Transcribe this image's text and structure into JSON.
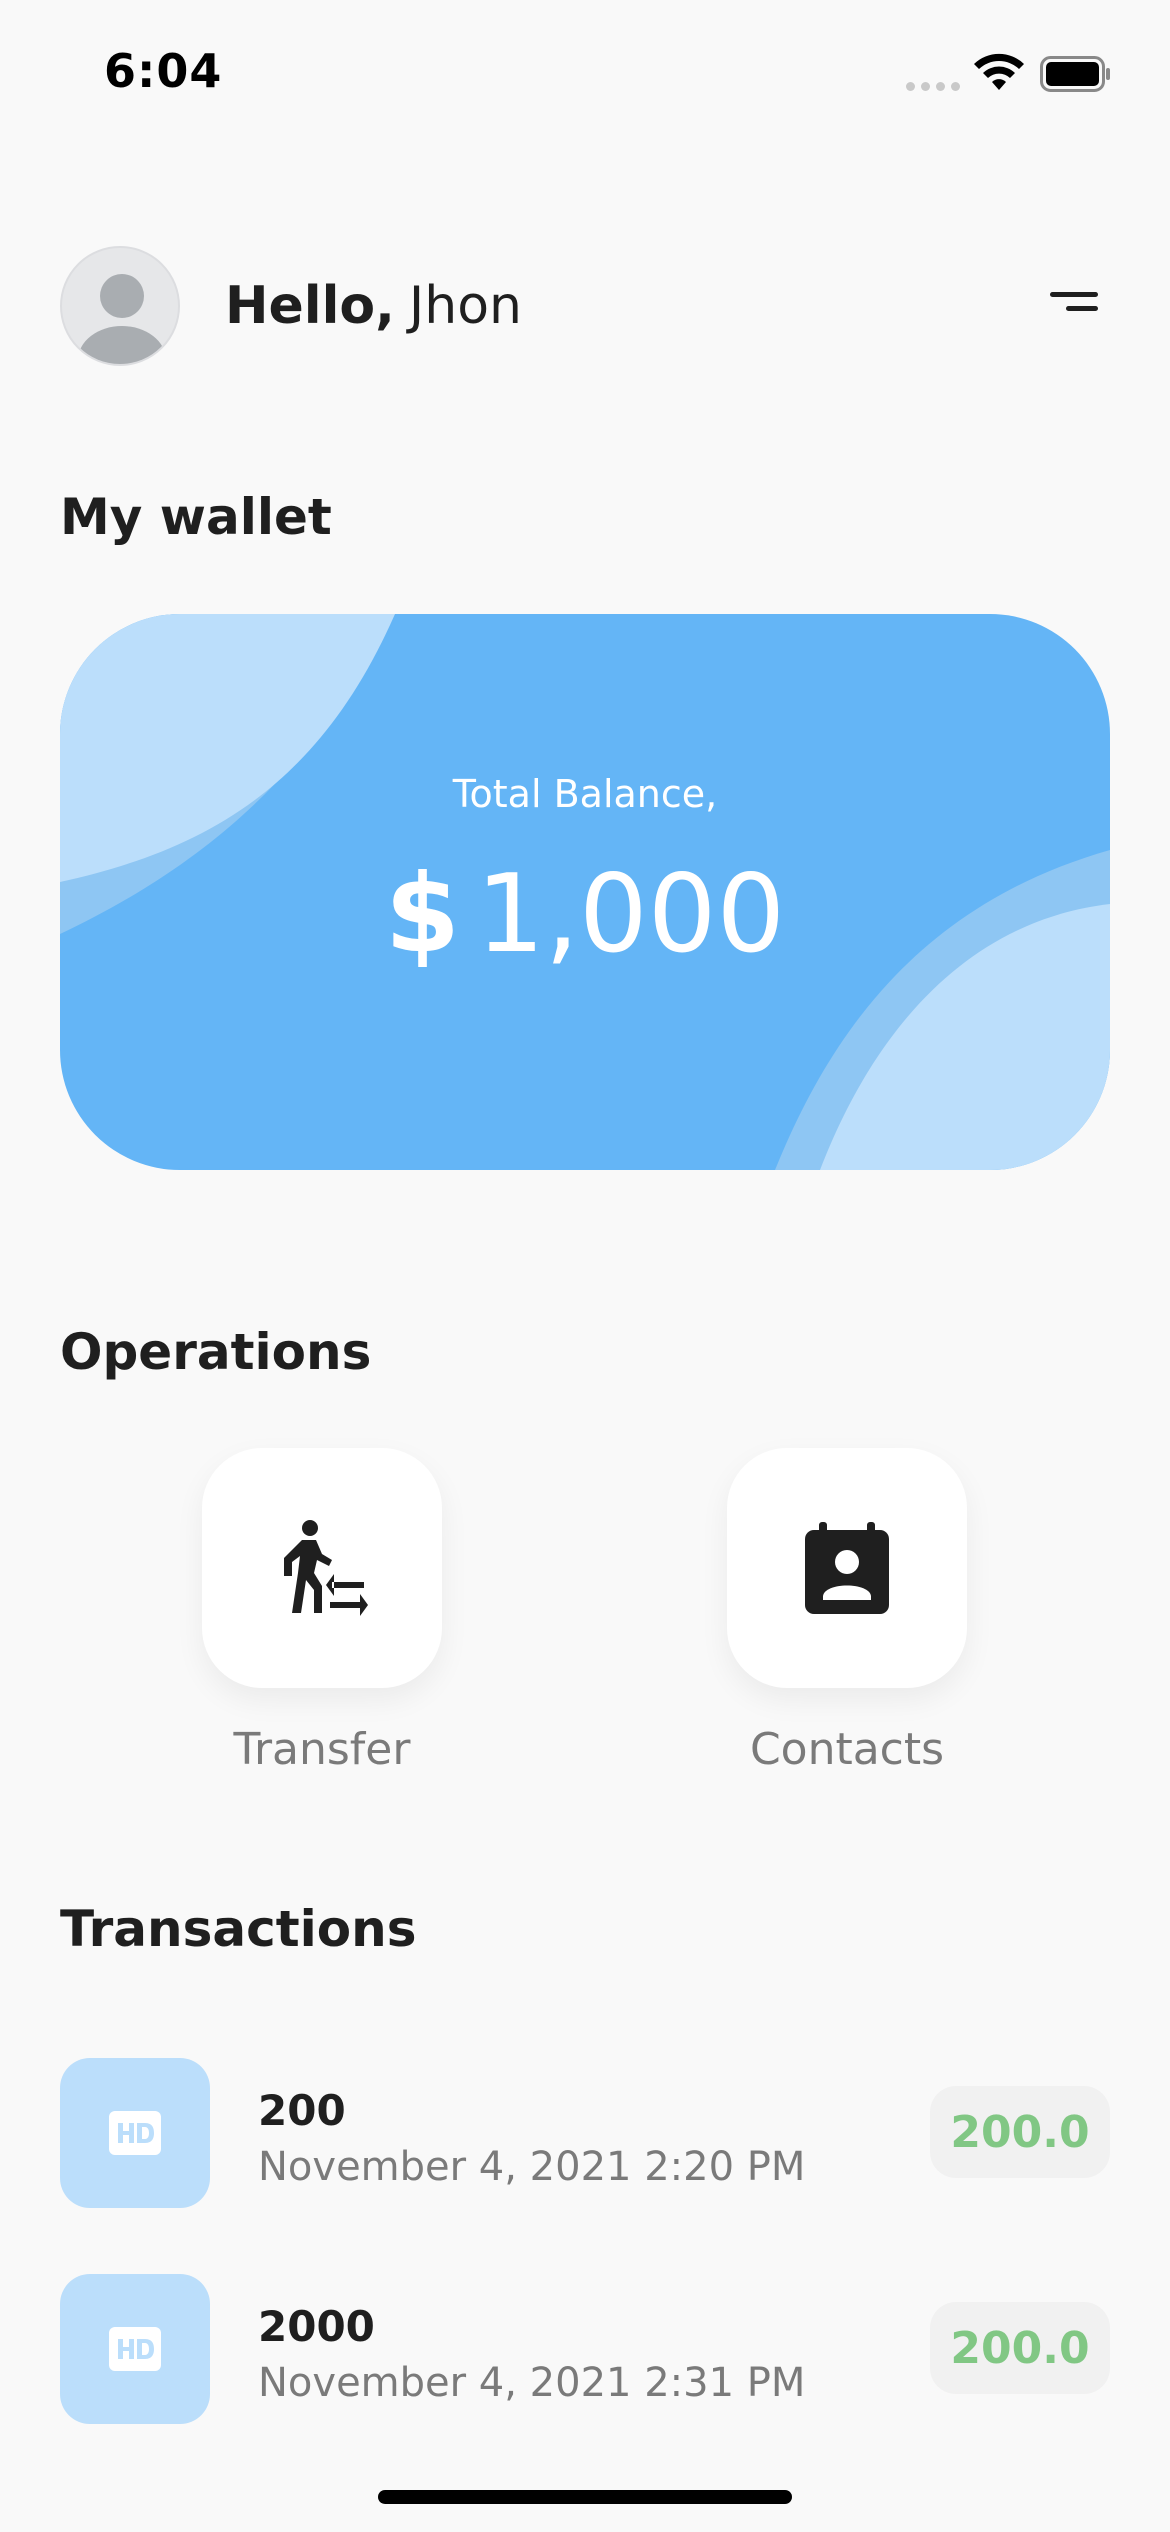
{
  "status_bar": {
    "time": "6:04"
  },
  "header": {
    "hello": "Hello,",
    "name": "Jhon"
  },
  "wallet": {
    "title": "My wallet",
    "balance_label": "Total Balance,",
    "currency": "$",
    "amount": "1,000",
    "card_color": "#64b5f6",
    "card_accent": "#bbdefb"
  },
  "operations": {
    "title": "Operations",
    "items": [
      {
        "label": "Transfer",
        "icon": "transfer-icon"
      },
      {
        "label": "Contacts",
        "icon": "contacts-icon"
      }
    ]
  },
  "transactions": {
    "title": "Transactions",
    "items": [
      {
        "title": "200",
        "date": "November 4, 2021 2:20 PM",
        "amount": "200.0"
      },
      {
        "title": "2000",
        "date": "November 4, 2021 2:31 PM",
        "amount": "200.0"
      }
    ],
    "amount_color": "#81c784"
  }
}
